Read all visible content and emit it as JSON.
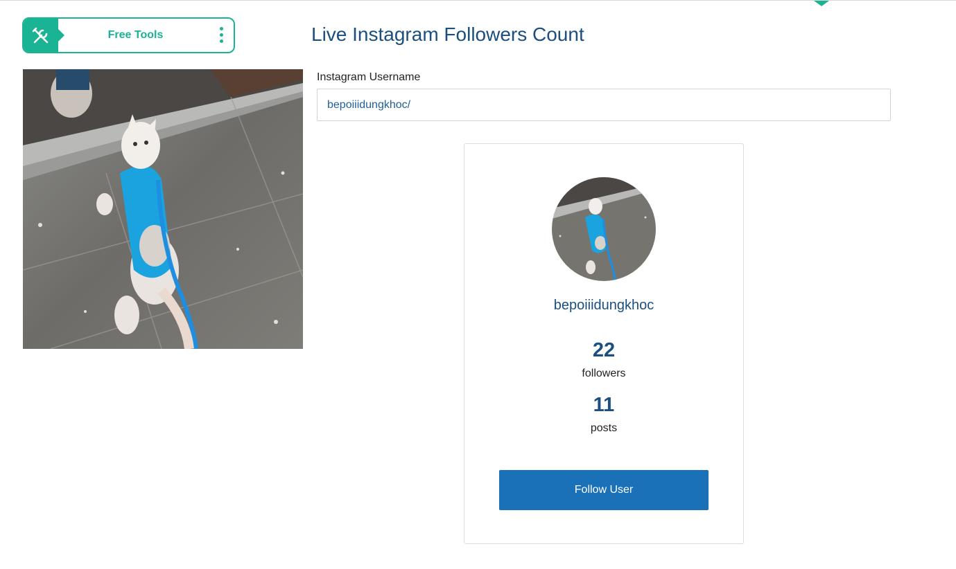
{
  "tools": {
    "label": "Free Tools",
    "icon": "tools-icon",
    "menu_icon": "kebab-menu-icon"
  },
  "header": {
    "title": "Live Instagram Followers Count"
  },
  "form": {
    "username_label": "Instagram Username",
    "username_value": "bepoiiidungkhoc/"
  },
  "profile": {
    "username": "bepoiiidungkhoc",
    "followers_count": "22",
    "followers_label": "followers",
    "posts_count": "11",
    "posts_label": "posts",
    "follow_button_label": "Follow User"
  },
  "colors": {
    "accent_teal": "#1ab394",
    "title_blue": "#1a4f80",
    "button_blue": "#1a71b8"
  }
}
